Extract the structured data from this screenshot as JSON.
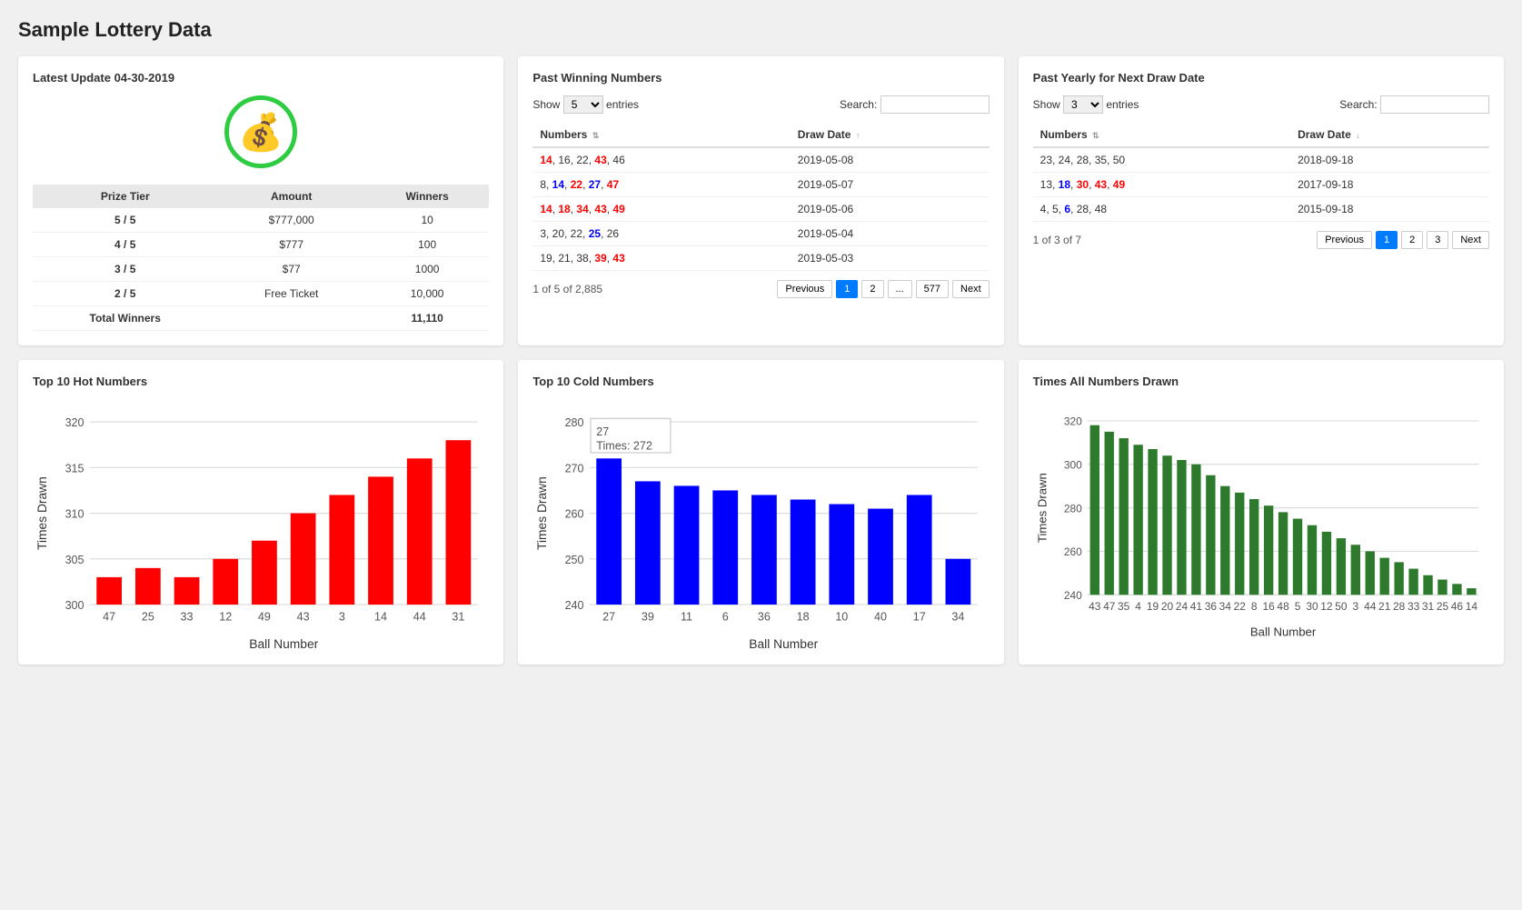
{
  "page_title": "Sample Lottery Data",
  "latest_update": {
    "title": "Latest Update 04-30-2019",
    "coin_icon": "🪙",
    "prize_table": {
      "headers": [
        "Prize Tier",
        "Amount",
        "Winners"
      ],
      "rows": [
        [
          "5 / 5",
          "$777,000",
          "10"
        ],
        [
          "4 / 5",
          "$777",
          "100"
        ],
        [
          "3 / 5",
          "$77",
          "1000"
        ],
        [
          "2 / 5",
          "Free Ticket",
          "10,000"
        ],
        [
          "Total Winners",
          "",
          "11,110"
        ]
      ]
    }
  },
  "past_winning": {
    "title": "Past Winning Numbers",
    "show_label": "Show",
    "show_value": "5",
    "entries_label": "entries",
    "search_label": "Search:",
    "search_placeholder": "",
    "headers": [
      "Numbers",
      "Draw Date"
    ],
    "rows": [
      {
        "numbers": "14, 16, 22, 43, 46",
        "date": "2019-05-08"
      },
      {
        "numbers": "8, 14, 22, 27, 47",
        "date": "2019-05-07"
      },
      {
        "numbers": "14, 18, 34, 43, 49",
        "date": "2019-05-06"
      },
      {
        "numbers": "3, 20, 22, 25, 26",
        "date": "2019-05-04"
      },
      {
        "numbers": "19, 21, 38, 39, 43",
        "date": "2019-05-03"
      }
    ],
    "pager_info": "1 of 5 of 2,885",
    "pages": [
      "1",
      "2",
      "...",
      "577"
    ],
    "prev_label": "Previous",
    "next_label": "Next"
  },
  "past_yearly": {
    "title": "Past Yearly for Next Draw Date",
    "show_label": "Show",
    "show_value": "3",
    "entries_label": "entries",
    "search_label": "Search:",
    "search_placeholder": "",
    "headers": [
      "Numbers",
      "Draw Date"
    ],
    "rows": [
      {
        "numbers": "23, 24, 28, 35, 50",
        "date": "2018-09-18"
      },
      {
        "numbers": "13, 18, 30, 43, 49",
        "date": "2017-09-18"
      },
      {
        "numbers": "4, 5, 6, 28, 48",
        "date": "2015-09-18"
      }
    ],
    "pager_info": "1 of 3 of 7",
    "pages": [
      "1",
      "2",
      "3"
    ],
    "prev_label": "Previous",
    "next_label": "Next"
  },
  "hot_numbers": {
    "title": "Top 10 Hot Numbers",
    "y_label": "Times Drawn",
    "x_label": "Ball Number",
    "y_min": 300,
    "y_max": 320,
    "y_ticks": [
      300,
      305,
      310,
      315,
      320
    ],
    "bars": [
      {
        "label": "47",
        "value": 303
      },
      {
        "label": "25",
        "value": 304
      },
      {
        "label": "33",
        "value": 303
      },
      {
        "label": "12",
        "value": 305
      },
      {
        "label": "49",
        "value": 307
      },
      {
        "label": "43",
        "value": 310
      },
      {
        "label": "3",
        "value": 312
      },
      {
        "label": "14",
        "value": 314
      },
      {
        "label": "44",
        "value": 316
      },
      {
        "label": "31",
        "value": 318
      }
    ]
  },
  "cold_numbers": {
    "title": "Top 10 Cold Numbers",
    "y_label": "Times Drawn",
    "x_label": "Ball Number",
    "y_min": 240,
    "y_max": 280,
    "y_ticks": [
      240,
      250,
      260,
      270,
      280
    ],
    "tooltip_ball": "27",
    "tooltip_times": "272",
    "bars": [
      {
        "label": "27",
        "value": 272
      },
      {
        "label": "39",
        "value": 267
      },
      {
        "label": "11",
        "value": 266
      },
      {
        "label": "6",
        "value": 265
      },
      {
        "label": "36",
        "value": 264
      },
      {
        "label": "18",
        "value": 263
      },
      {
        "label": "10",
        "value": 262
      },
      {
        "label": "40",
        "value": 261
      },
      {
        "label": "17",
        "value": 264
      },
      {
        "label": "34",
        "value": 250
      }
    ]
  },
  "all_numbers": {
    "title": "Times All Numbers Drawn",
    "y_label": "Times Drawn",
    "x_label": "Ball Number",
    "y_min": 240,
    "y_max": 320,
    "y_ticks": [
      240,
      260,
      280,
      300,
      320
    ],
    "bars": [
      {
        "label": "43",
        "value": 318
      },
      {
        "label": "47",
        "value": 315
      },
      {
        "label": "35",
        "value": 312
      },
      {
        "label": "4",
        "value": 309
      },
      {
        "label": "19",
        "value": 307
      },
      {
        "label": "20",
        "value": 304
      },
      {
        "label": "24",
        "value": 302
      },
      {
        "label": "41",
        "value": 300
      },
      {
        "label": "36",
        "value": 295
      },
      {
        "label": "34",
        "value": 290
      },
      {
        "label": "22",
        "value": 287
      },
      {
        "label": "8",
        "value": 284
      },
      {
        "label": "16",
        "value": 281
      },
      {
        "label": "48",
        "value": 278
      },
      {
        "label": "5",
        "value": 275
      },
      {
        "label": "30",
        "value": 272
      },
      {
        "label": "12",
        "value": 269
      },
      {
        "label": "50",
        "value": 266
      },
      {
        "label": "3",
        "value": 263
      },
      {
        "label": "44",
        "value": 260
      },
      {
        "label": "21",
        "value": 257
      },
      {
        "label": "28",
        "value": 255
      },
      {
        "label": "33",
        "value": 252
      },
      {
        "label": "31",
        "value": 249
      },
      {
        "label": "25",
        "value": 247
      },
      {
        "label": "46",
        "value": 245
      },
      {
        "label": "14",
        "value": 243
      }
    ]
  }
}
